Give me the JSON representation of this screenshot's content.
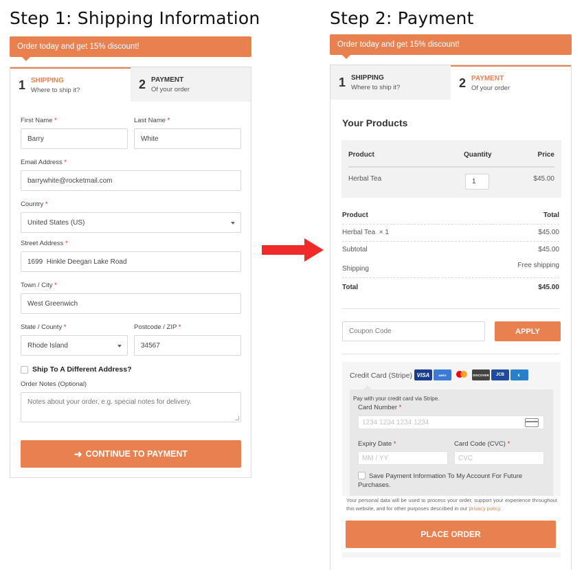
{
  "step1": {
    "title": "Step 1: Shipping Information",
    "banner": "Order today and get 15% discount!",
    "tabs": [
      {
        "num": "1",
        "label": "SHIPPING",
        "sub": "Where to ship it?",
        "active": true
      },
      {
        "num": "2",
        "label": "PAYMENT",
        "sub": "Of your order",
        "active": false
      }
    ],
    "form": {
      "first_name": {
        "label": "First Name",
        "required": "*",
        "value": "Barry"
      },
      "last_name": {
        "label": "Last Name",
        "required": "*",
        "value": "White"
      },
      "email": {
        "label": "Email Address",
        "required": "*",
        "value": "barrywhite@rocketmail.com"
      },
      "country": {
        "label": "Country",
        "required": "*",
        "value": "United States (US)"
      },
      "street": {
        "label": "Street Address",
        "required": "*",
        "value": "1699  Hinkle Deegan Lake Road"
      },
      "city": {
        "label": "Town / City",
        "required": "*",
        "value": "West Greenwich"
      },
      "state": {
        "label": "State / County",
        "required": "*",
        "value": "Rhode Island"
      },
      "zip": {
        "label": "Postcode / ZIP",
        "required": "*",
        "value": "34567"
      },
      "ship_different": {
        "label": "Ship To A Different Address?",
        "checked": false
      },
      "notes": {
        "label": "Order Notes (Optional)",
        "placeholder": "Notes about your order, e.g. special notes for delivery."
      }
    },
    "continue_button": "CONTINUE TO PAYMENT",
    "continue_icon": "arrow-right-icon"
  },
  "transition_icon": "red-arrow-right-icon",
  "step2": {
    "title": "Step 2: Payment",
    "banner": "Order today and get 15% discount!",
    "tabs": [
      {
        "num": "1",
        "label": "SHIPPING",
        "sub": "Where to ship it?",
        "active": false
      },
      {
        "num": "2",
        "label": "PAYMENT",
        "sub": "Of your order",
        "active": true
      }
    ],
    "products": {
      "title": "Your Products",
      "headers": [
        "Product",
        "Quantity",
        "Price"
      ],
      "rows": [
        {
          "product": "Herbal Tea",
          "quantity": "1",
          "price": "$45.00"
        }
      ]
    },
    "order_summary": {
      "headers": [
        "Product",
        "Total"
      ],
      "item": {
        "label": "Herbal Tea",
        "qty": "× 1",
        "total": "$45.00"
      },
      "subtotal": {
        "label": "Subtotal",
        "value": "$45.00"
      },
      "shipping": {
        "label": "Shipping",
        "value": "Free shipping"
      },
      "total": {
        "label": "Total",
        "value": "$45.00"
      }
    },
    "coupon": {
      "placeholder": "Coupon Code",
      "button": "APPLY"
    },
    "payment": {
      "method_label": "Credit Card (Stripe)",
      "card_brands": [
        "VISA",
        "AMEX",
        "Mastercard",
        "DISCOVER",
        "JCB",
        "Diners"
      ],
      "note": "Pay with your credit card via Stripe.",
      "card_number": {
        "label": "Card Number",
        "required": "*",
        "placeholder": "1234 1234 1234 1234"
      },
      "expiry": {
        "label": "Expiry Date",
        "required": "*",
        "placeholder": "MM / YY"
      },
      "cvc": {
        "label": "Card Code (CVC)",
        "required": "*",
        "placeholder": "CVC"
      },
      "save_info": {
        "label": "Save Payment Information To My Account For Future Purchases.",
        "checked": false
      }
    },
    "privacy": {
      "text": "Your personal data will be used to process your order, support your experience throughout this website, and for other purposes described in our ",
      "link": "privacy policy",
      "end": "."
    },
    "place_order_button": "PLACE ORDER"
  },
  "colors": {
    "accent": "#e9804f",
    "required": "#e02424",
    "arrow": "#f02a2a"
  }
}
